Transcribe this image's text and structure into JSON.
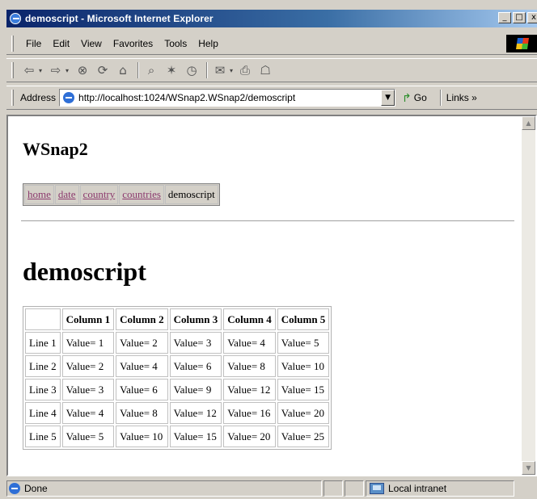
{
  "window": {
    "title": "demoscript - Microsoft Internet Explorer",
    "minimize": "_",
    "maximize": "□",
    "close": "x"
  },
  "menubar": {
    "items": [
      {
        "label": "File"
      },
      {
        "label": "Edit"
      },
      {
        "label": "View"
      },
      {
        "label": "Favorites"
      },
      {
        "label": "Tools"
      },
      {
        "label": "Help"
      }
    ]
  },
  "toolbar": {
    "back_icon": "⇦",
    "forward_icon": "⇨",
    "dropdown_glyph": "▾",
    "stop_icon": "⊗",
    "refresh_icon": "⟳",
    "home_icon": "⌂",
    "search_icon": "⌕",
    "favorites_icon": "✶",
    "history_icon": "◷",
    "mail_icon": "✉",
    "print_icon": "⎙",
    "discuss_icon": "☖"
  },
  "addressbar": {
    "label": "Address",
    "url": "http://localhost:1024/WSnap2.WSnap2/demoscript",
    "dropdown_glyph": "▼",
    "go_label": "Go",
    "go_icon": "↱",
    "links_label": "Links »"
  },
  "page": {
    "site_title": "WSnap2",
    "nav": [
      {
        "label": "home",
        "link": true
      },
      {
        "label": "date",
        "link": true
      },
      {
        "label": "country",
        "link": true
      },
      {
        "label": "countries",
        "link": true
      },
      {
        "label": "demoscript",
        "link": false
      }
    ],
    "heading": "demoscript",
    "table": {
      "columns": [
        "",
        "Column 1",
        "Column 2",
        "Column 3",
        "Column 4",
        "Column 5"
      ],
      "rows": [
        [
          "Line 1",
          "Value= 1",
          "Value= 2",
          "Value= 3",
          "Value= 4",
          "Value= 5"
        ],
        [
          "Line 2",
          "Value= 2",
          "Value= 4",
          "Value= 6",
          "Value= 8",
          "Value= 10"
        ],
        [
          "Line 3",
          "Value= 3",
          "Value= 6",
          "Value= 9",
          "Value= 12",
          "Value= 15"
        ],
        [
          "Line 4",
          "Value= 4",
          "Value= 8",
          "Value= 12",
          "Value= 16",
          "Value= 20"
        ],
        [
          "Line 5",
          "Value= 5",
          "Value= 10",
          "Value= 15",
          "Value= 20",
          "Value= 25"
        ]
      ]
    }
  },
  "scrollbar": {
    "up_glyph": "▲",
    "down_glyph": "▼"
  },
  "statusbar": {
    "status": "Done",
    "zone": "Local intranet"
  },
  "colors": {
    "titlebar_start": "#0a246a",
    "titlebar_end": "#a6caf0",
    "chrome": "#d4d0c8",
    "visited_link": "#8c3a6e"
  }
}
